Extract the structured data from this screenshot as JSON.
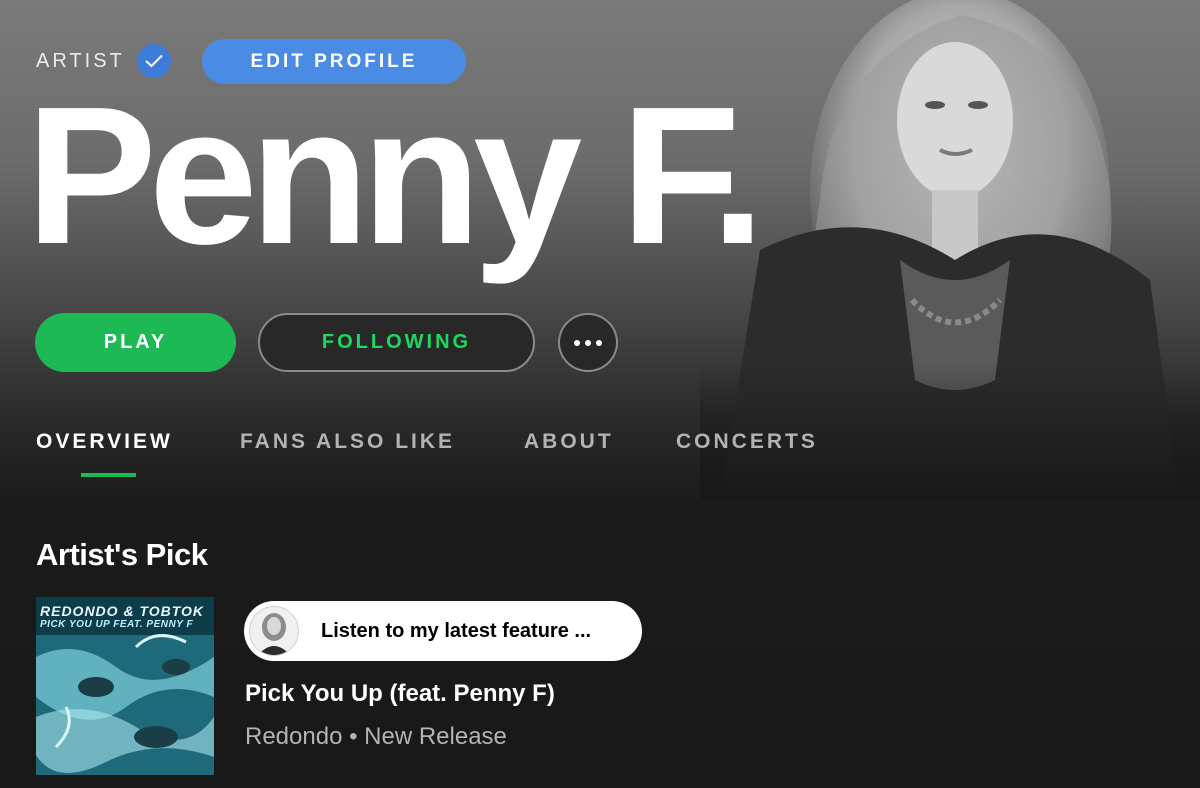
{
  "header": {
    "artist_label": "ARTIST",
    "edit_profile_label": "EDIT PROFILE",
    "artist_name": "Penny F.",
    "verified_icon": "verified-check-icon"
  },
  "actions": {
    "play_label": "PLAY",
    "following_label": "FOLLOWING",
    "more_icon": "more-options-icon"
  },
  "tabs": [
    {
      "label": "OVERVIEW",
      "active": true
    },
    {
      "label": "FANS ALSO LIKE",
      "active": false
    },
    {
      "label": "ABOUT",
      "active": false
    },
    {
      "label": "CONCERTS",
      "active": false
    }
  ],
  "artists_pick": {
    "section_title": "Artist's Pick",
    "cover_line_1": "REDONDO & TOBTOK",
    "cover_line_2": "PICK YOU UP FEAT. PENNY F",
    "message": "Listen to my latest feature ...",
    "track_title": "Pick You Up (feat. Penny F)",
    "track_meta": "Redondo • New Release"
  },
  "colors": {
    "accent_green": "#1db954",
    "following_green": "#1ed760",
    "edit_blue": "#4a8ce3",
    "background": "#181818"
  }
}
